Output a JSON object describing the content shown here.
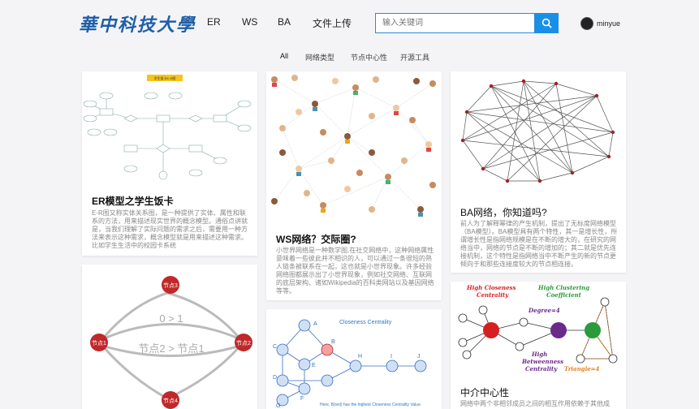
{
  "header": {
    "logo": "華中科技大學",
    "nav": [
      "ER",
      "WS",
      "BA",
      "文件上传"
    ],
    "search_placeholder": "输入关键词",
    "username": "minyue"
  },
  "filters": [
    "All",
    "网络类型",
    "节点中心性",
    "开源工具"
  ],
  "cards": {
    "er": {
      "title": "ER模型之学生饭卡",
      "badge": "学生饭卡E-R图",
      "desc": "E-R图又称实体关系图，是一种提供了实体、属性和联系的方法，用来描述现实世界的概念模型。通俗点讲就是，当我们理解了实际问题的需求之后，需要用一种方法来表示这种需求，概念模型就是用来描述这种需求。比如学生生活中的校园卡系统"
    },
    "ws": {
      "title": "WS网络？交际圈?",
      "desc": "小世界网络是一种数学图,在社交网络中，这种网络属性意味着一些彼此并不相识的人，可以通过一条很短的熟人链条被联系在一起，这也就是小世界现象。许多经验网络图都展示出了小世界现象，例如社交网络、互联网的底层架构、诸如Wikipedia的百科类网站以及基因网络等等。"
    },
    "ba": {
      "title": "BA网络，你知道吗?",
      "desc": "前人为了解释幂律的产生机制，提出了无标度网络模型（BA模型）。BA模型具有两个特性，其一是增长性，所谓增长性是指网络规模是在不断的增大的，在研究的网络当中，网络的节点是不断的增加的；其二就是优先连接机制，这个特性是指网络当中不断产生的新的节点更倾向于和那些连接度较大的节点相连接。"
    },
    "node": {
      "n3": "节点3",
      "n1": "节点1",
      "n2": "节点2",
      "n4": "节点4",
      "e1": "0 > 1",
      "e2": "节点2 > 节点1"
    },
    "closeness": {
      "title": "Closeness Centrality",
      "labels": [
        "A",
        "B",
        "C",
        "D",
        "E",
        "F",
        "G",
        "H",
        "I",
        "J"
      ],
      "caption": "Here, B(red) has the highest Closeness Centrality Value"
    },
    "between": {
      "title": "中介中心性",
      "desc": "网络中两个非相邻成员之间的相互作用依赖于其他成",
      "l1": "High Closeness",
      "l1b": "Centrality",
      "l2": "High Clustering",
      "l2b": "Coefficient",
      "l3": "Degree=4",
      "l4": "High",
      "l4b": "Betweenness",
      "l4c": "Centrality",
      "l5": "Triangle=4"
    }
  },
  "colors": {
    "accent": "#1890e8",
    "brand": "#1e5fa8",
    "node_red": "#c0282a"
  }
}
